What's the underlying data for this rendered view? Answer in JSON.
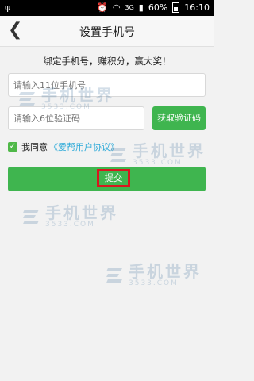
{
  "statusbar": {
    "left_icons": "ψ",
    "time": "16:10",
    "battery_text": "60%",
    "network": "3G"
  },
  "header": {
    "back_glyph": "❮",
    "title": "设置手机号"
  },
  "tagline": "绑定手机号，赚积分，赢大奖！",
  "form": {
    "phone_placeholder": "请输入11位手机号",
    "code_placeholder": "请输入6位验证码",
    "get_code_label": "获取验证码",
    "agree_prefix": "我同意",
    "agree_link": "《爱帮用户协议》",
    "submit_label": "提交"
  },
  "watermark": {
    "title": "手机世界",
    "sub": "3533.COM"
  },
  "colors": {
    "accent_green": "#3fb54f",
    "link_blue": "#2aa9d8",
    "highlight_red": "#d8171f"
  }
}
